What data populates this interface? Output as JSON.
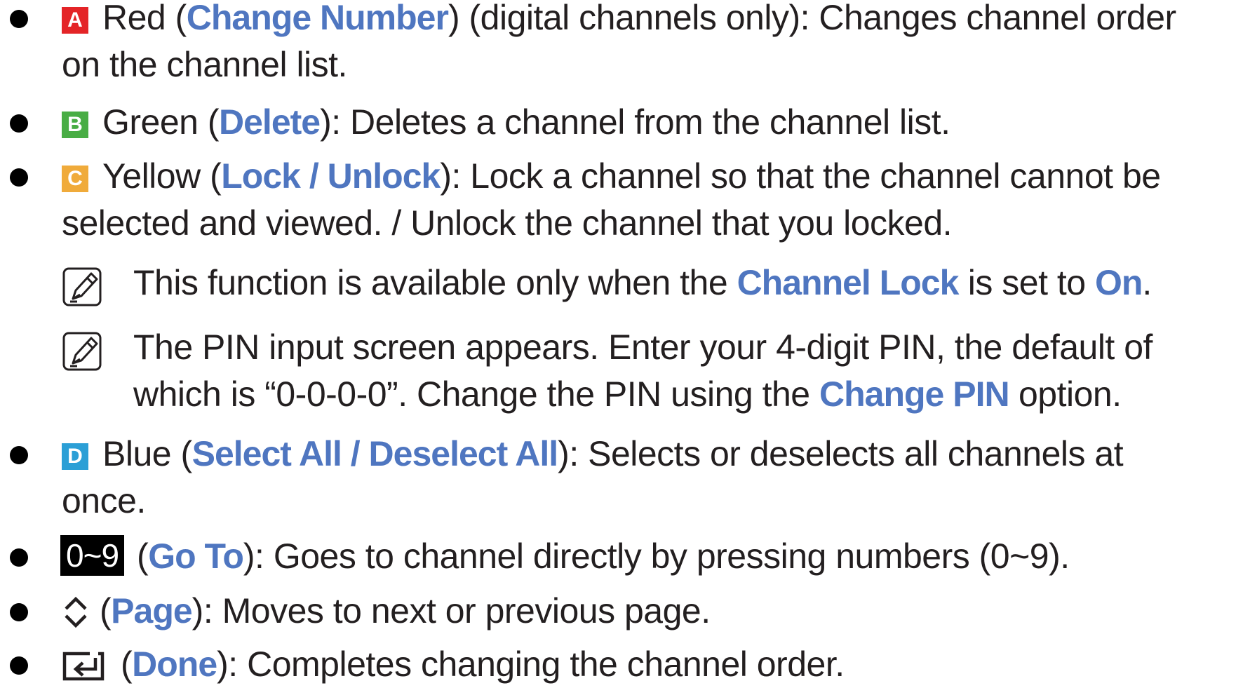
{
  "items": [
    {
      "key_label": "A",
      "key_color": "#e42427",
      "color_name": "Red",
      "action": "Change Number",
      "qualifier": " (digital channels only): Changes channel order",
      "line2": "on the channel list."
    },
    {
      "key_label": "B",
      "key_color": "#48ad44",
      "color_name": "Green",
      "action": "Delete",
      "desc": "): Deletes a channel from the channel list."
    },
    {
      "key_label": "C",
      "key_color": "#f0ab3b",
      "color_name": "Yellow",
      "action": "Lock / Unlock",
      "desc": "): Lock a channel so that the channel cannot be",
      "line2": "selected and viewed. / Unlock the channel that you locked."
    },
    {
      "key_label": "D",
      "key_color": "#2b9fd6",
      "color_name": "Blue",
      "action": "Select All / Deselect All",
      "desc": "): Selects or deselects all channels at",
      "line2": "once."
    },
    {
      "key_label": "0~9",
      "action": "Go To",
      "desc": "): Goes to channel directly by pressing numbers (0~9)."
    },
    {
      "icon": "up-down-chevron-icon",
      "action": "Page",
      "desc": "): Moves to next or previous page."
    },
    {
      "icon": "enter-return-icon",
      "action": "Done",
      "desc": "): Completes changing the channel order."
    }
  ],
  "notes": [
    {
      "icon": "note-pencil-icon",
      "pre": "This function is available only when the ",
      "hl1": "Channel Lock",
      "mid": " is set to ",
      "hl2": "On",
      "post": "."
    },
    {
      "icon": "note-pencil-icon",
      "line1": "The PIN input screen appears. Enter your 4-digit PIN, the default of",
      "pre2": "which is “0-0-0-0”. Change the PIN using the ",
      "hl": "Change PIN",
      "post2": " option."
    }
  ],
  "colors": {
    "highlight": "#4f76c0",
    "text": "#231f20"
  }
}
